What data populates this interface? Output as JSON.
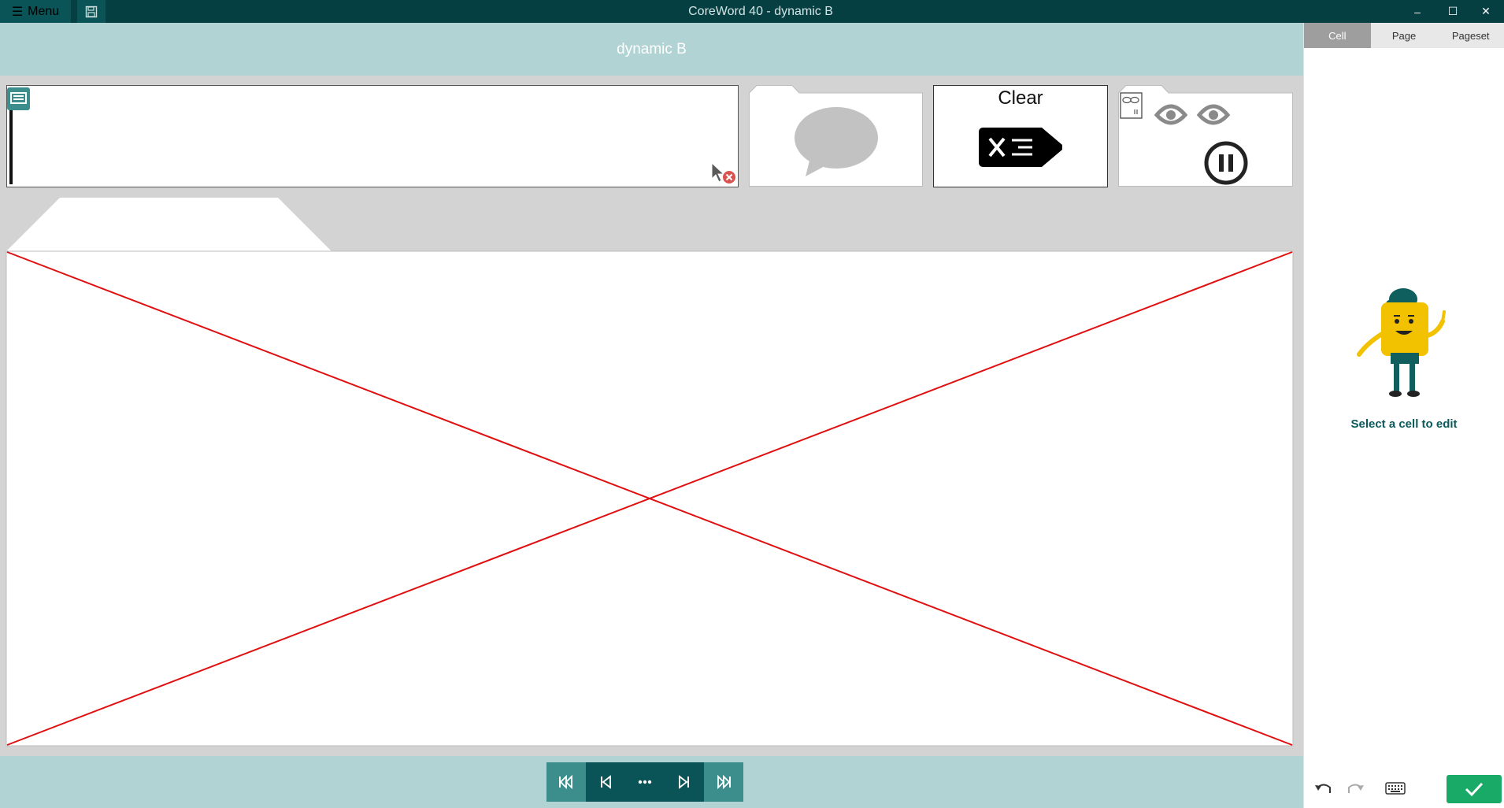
{
  "titlebar": {
    "menu_label": "Menu",
    "window_title": "CoreWord 40 - dynamic B",
    "minimize": "–",
    "maximize": "☐",
    "close": "✕"
  },
  "page": {
    "title": "dynamic B"
  },
  "cells": {
    "clear_label": "Clear"
  },
  "sidepanel": {
    "tabs": [
      "Cell",
      "Page",
      "Pageset"
    ],
    "active_tab": "Cell",
    "hint": "Select a cell to edit"
  },
  "nav": {
    "buttons": [
      "first-page",
      "previous-page",
      "more",
      "next-page",
      "last-page"
    ]
  },
  "colors": {
    "titlebar": "#063f42",
    "header": "#b2d3d3",
    "accent": "#0a5356",
    "confirm": "#1aaa67",
    "placeholder_x": "#e01010"
  }
}
